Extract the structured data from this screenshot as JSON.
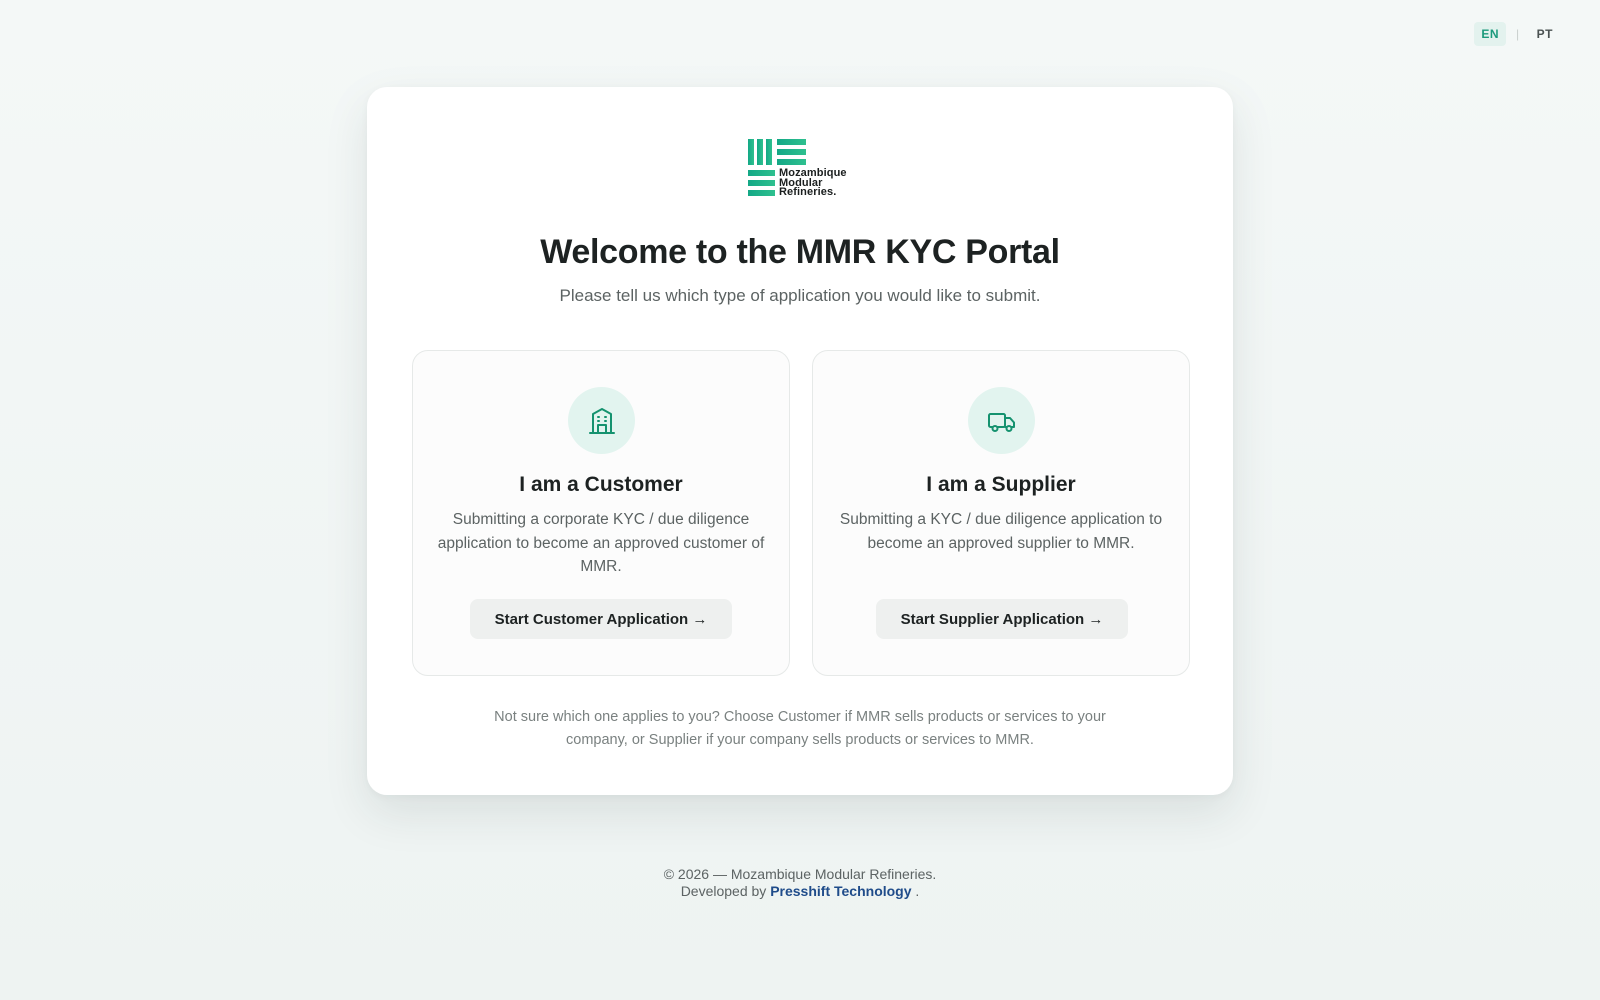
{
  "language": {
    "options": [
      {
        "code": "EN",
        "active": true
      },
      {
        "code": "PT",
        "active": false
      }
    ],
    "separator": "|"
  },
  "brand": {
    "name_lines": [
      "Mozambique",
      "Modular",
      "Refineries."
    ],
    "accent_color": "#1bb08d"
  },
  "header": {
    "title": "Welcome to the MMR KYC Portal",
    "subtitle": "Please tell us which type of application you would like to submit."
  },
  "options": {
    "customer": {
      "icon": "building-icon",
      "title": "I am a Customer",
      "description": "Submitting a corporate KYC / due diligence application to become an approved customer of MMR.",
      "button_label": "Start Customer Application →"
    },
    "supplier": {
      "icon": "truck-icon",
      "title": "I am a Supplier",
      "description": "Submitting a KYC / due diligence application to become an approved supplier to MMR.",
      "button_label": "Start Supplier Application →"
    }
  },
  "help_text": "Not sure which one applies to you? Choose Customer if MMR sells products or services to your company, or Supplier if your company sells products or services to MMR.",
  "footer": {
    "copyright": "© 2026 — Mozambique Modular Refineries.",
    "developed_by_prefix": "Developed by",
    "developer_name": "Presshift Technology",
    "developed_by_suffix": "."
  }
}
